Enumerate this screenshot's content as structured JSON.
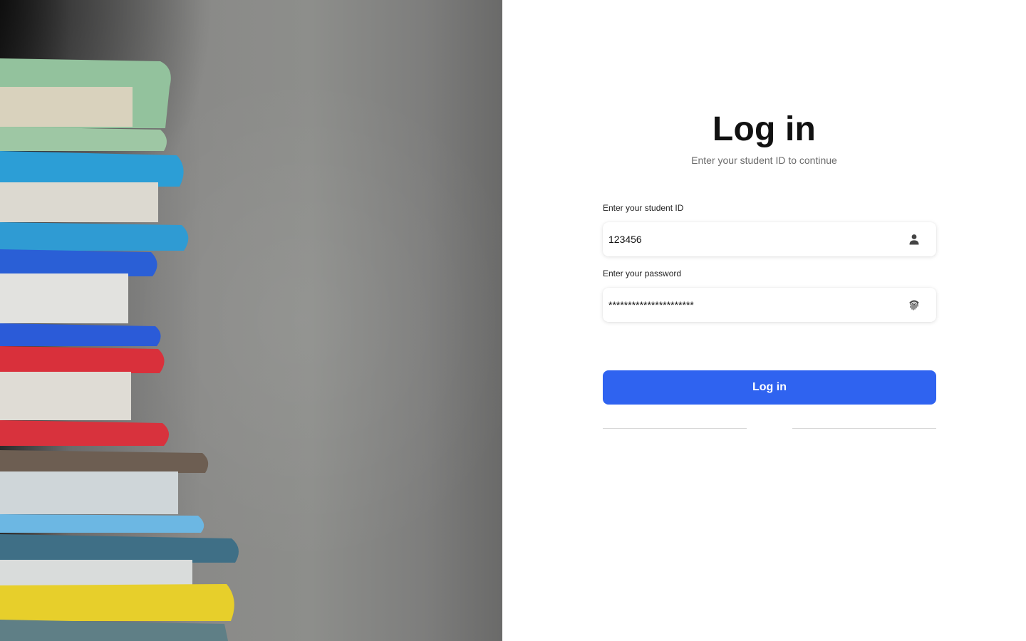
{
  "hero": {
    "description": ""
  },
  "login": {
    "title": "Log in",
    "subtitle": "Enter your student ID to continue",
    "student_id": {
      "label": "Enter your student ID",
      "value": "123456",
      "icon": "person-icon"
    },
    "password": {
      "label": "Enter your password",
      "value": "**********************",
      "icon": "fingerprint-icon"
    },
    "submit_label": "Log in"
  },
  "colors": {
    "accent": "#2f63f0",
    "title": "#111111",
    "subtitle": "#6b6b6b",
    "divider": "#d6d6d6"
  }
}
